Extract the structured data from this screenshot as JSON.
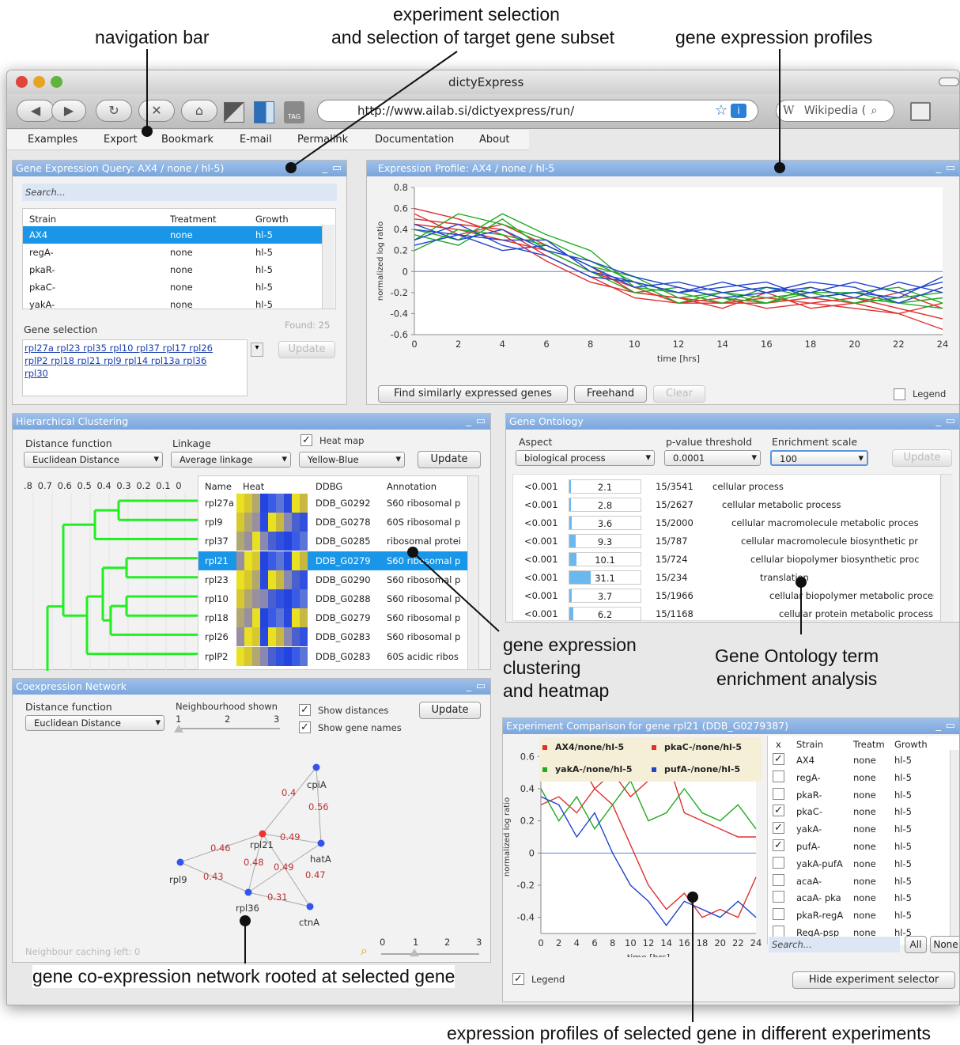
{
  "callouts": {
    "experiment_selection": "experiment selection\nand selection of target gene subset",
    "experiment_selection_l1": "experiment selection",
    "experiment_selection_l2": "and selection of target gene subset",
    "navigation_bar": "navigation bar",
    "gene_expression_profiles": "gene expression profiles",
    "clustering_l1": "gene expression",
    "clustering_l2": "clustering",
    "clustering_l3": "and heatmap",
    "go_l1": "Gene Ontology term",
    "go_l2": "enrichment analysis",
    "network": "gene co-expression network rooted at selected gene",
    "experiments": "expression profiles of selected gene in different experiments"
  },
  "browser": {
    "title": "dictyExpress",
    "url": "http://www.ailab.si/dictyexpress/run/",
    "search_engine": "Wikipedia (",
    "search_engine_icon": "W",
    "tag_label": "TAG"
  },
  "menu": [
    "Examples",
    "Export",
    "Bookmark",
    "E-mail",
    "Permalink",
    "Documentation",
    "About"
  ],
  "query_panel": {
    "title": "Gene Expression Query: AX4 / none / hl-5)",
    "search_placeholder": "Search...",
    "columns": [
      "Strain",
      "Treatment",
      "Growth"
    ],
    "rows": [
      [
        "AX4",
        "none",
        "hl-5"
      ],
      [
        "regA-",
        "none",
        "hl-5"
      ],
      [
        "pkaR-",
        "none",
        "hl-5"
      ],
      [
        "pkaC-",
        "none",
        "hl-5"
      ],
      [
        "yakA-",
        "none",
        "hl-5"
      ]
    ],
    "found": "Found: 25",
    "gene_selection_label": "Gene selection",
    "genes_line1": "rpl27a rpl23 rpl35 rpl10 rpl37 rpl17 rpl26",
    "genes_line2": "rplP2 rpl18 rpl21 rpl9 rpl14 rpl13a rpl36",
    "genes_line3": "rpl30",
    "update": "Update"
  },
  "profile_panel": {
    "title": "Expression Profile: AX4 / none / hl-5",
    "ylabel": "normalized log ratio",
    "xlabel": "time [hrs]",
    "btn_find": "Find similarly expressed genes",
    "btn_freehand": "Freehand",
    "btn_clear": "Clear",
    "legend": "Legend"
  },
  "chart_data": [
    {
      "type": "line",
      "title": "Expression Profile: AX4 / none / hl-5",
      "xlabel": "time [hrs]",
      "ylabel": "normalized log ratio",
      "x": [
        0,
        2,
        4,
        6,
        8,
        10,
        12,
        14,
        16,
        18,
        20,
        22,
        24
      ],
      "xticks": [
        "0",
        "2",
        "4",
        "6",
        "8",
        "10",
        "12",
        "14",
        "16",
        "18",
        "20",
        "22",
        "24"
      ],
      "yticks": [
        "0.8",
        "0.6",
        "0.4",
        "0.2",
        "0",
        "-0.2",
        "-0.4",
        "-0.6"
      ],
      "ylim": [
        -0.6,
        0.8
      ],
      "xlim": [
        0,
        24
      ],
      "series": [
        {
          "color": "#e03030",
          "values": [
            0.6,
            0.5,
            0.35,
            0.1,
            -0.1,
            -0.2,
            -0.25,
            -0.3,
            -0.25,
            -0.3,
            -0.35,
            -0.4,
            -0.55
          ]
        },
        {
          "color": "#e03030",
          "values": [
            0.5,
            0.45,
            0.4,
            0.15,
            -0.05,
            -0.25,
            -0.3,
            -0.25,
            -0.35,
            -0.3,
            -0.25,
            -0.35,
            -0.45
          ]
        },
        {
          "color": "#e03030",
          "values": [
            0.45,
            0.4,
            0.3,
            0.2,
            0.0,
            -0.15,
            -0.3,
            -0.3,
            -0.3,
            -0.25,
            -0.3,
            -0.2,
            -0.35
          ]
        },
        {
          "color": "#e03030",
          "values": [
            0.55,
            0.35,
            0.45,
            0.25,
            0.05,
            -0.2,
            -0.25,
            -0.35,
            -0.2,
            -0.35,
            -0.3,
            -0.4,
            -0.3
          ]
        },
        {
          "color": "#22aa22",
          "values": [
            0.3,
            0.55,
            0.45,
            0.3,
            0.1,
            -0.1,
            -0.3,
            -0.2,
            -0.3,
            -0.15,
            -0.25,
            -0.3,
            -0.25
          ]
        },
        {
          "color": "#22aa22",
          "values": [
            0.4,
            0.3,
            0.55,
            0.35,
            0.2,
            -0.15,
            -0.2,
            -0.3,
            -0.15,
            -0.25,
            -0.2,
            -0.15,
            -0.3
          ]
        },
        {
          "color": "#22aa22",
          "values": [
            0.2,
            0.4,
            0.35,
            0.25,
            0.05,
            -0.05,
            -0.25,
            -0.2,
            -0.25,
            -0.2,
            -0.3,
            -0.25,
            -0.2
          ]
        },
        {
          "color": "#22aa22",
          "values": [
            0.35,
            0.25,
            0.5,
            0.2,
            0.0,
            -0.2,
            -0.15,
            -0.25,
            -0.3,
            -0.2,
            -0.2,
            -0.3,
            -0.35
          ]
        },
        {
          "color": "#2244cc",
          "values": [
            0.25,
            0.35,
            0.3,
            0.3,
            0.0,
            -0.1,
            -0.2,
            -0.15,
            -0.1,
            -0.25,
            -0.2,
            -0.25,
            -0.05
          ]
        },
        {
          "color": "#2244cc",
          "values": [
            0.4,
            0.35,
            0.2,
            0.25,
            0.05,
            -0.15,
            -0.1,
            -0.2,
            -0.15,
            -0.2,
            -0.1,
            -0.2,
            -0.1
          ]
        },
        {
          "color": "#2244cc",
          "values": [
            0.3,
            0.45,
            0.25,
            0.15,
            -0.05,
            -0.1,
            -0.2,
            -0.1,
            -0.2,
            -0.15,
            -0.25,
            -0.1,
            -0.2
          ]
        },
        {
          "color": "#2244cc",
          "values": [
            0.45,
            0.3,
            0.4,
            0.2,
            0.1,
            -0.05,
            -0.15,
            -0.25,
            -0.2,
            -0.1,
            -0.15,
            -0.3,
            -0.15
          ]
        }
      ]
    },
    {
      "type": "line",
      "title": "Experiment Comparison for gene rpl21 (DDB_G0279387)",
      "xlabel": "time [hrs]",
      "ylabel": "normalized log ratio",
      "x": [
        0,
        2,
        4,
        6,
        8,
        10,
        12,
        14,
        16,
        18,
        20,
        22,
        24
      ],
      "xticks": [
        "0",
        "2",
        "4",
        "6",
        "8",
        "10",
        "12",
        "14",
        "16",
        "18",
        "20",
        "22",
        "24"
      ],
      "yticks": [
        "0.6",
        "0.4",
        "0.2",
        "0",
        "-0.2",
        "-0.4"
      ],
      "ylim": [
        -0.5,
        0.7
      ],
      "xlim": [
        0,
        24
      ],
      "series": [
        {
          "name": "AX4/none/hl-5",
          "color": "#e03030",
          "values": [
            0.3,
            0.35,
            0.25,
            0.4,
            0.3,
            0.05,
            -0.2,
            -0.35,
            -0.25,
            -0.4,
            -0.35,
            -0.4,
            -0.15
          ]
        },
        {
          "name": "pkaC-/none/hl-5",
          "color": "#e03030",
          "values": [
            0.55,
            0.45,
            0.6,
            0.4,
            0.5,
            0.35,
            0.45,
            0.6,
            0.25,
            0.2,
            0.15,
            0.1,
            0.1
          ]
        },
        {
          "name": "yakA-/none/hl-5",
          "color": "#22aa22",
          "values": [
            0.4,
            0.2,
            0.35,
            0.15,
            0.3,
            0.45,
            0.2,
            0.25,
            0.4,
            0.25,
            0.2,
            0.3,
            0.15
          ]
        },
        {
          "name": "pufA-/none/hl-5",
          "color": "#2244cc",
          "values": [
            0.35,
            0.3,
            0.1,
            0.25,
            0.0,
            -0.2,
            -0.3,
            -0.45,
            -0.3,
            -0.35,
            -0.4,
            -0.3,
            -0.4
          ]
        }
      ]
    }
  ],
  "clustering_panel": {
    "title": "Hierarchical Clustering",
    "distance_label": "Distance function",
    "distance_value": "Euclidean Distance",
    "linkage_label": "Linkage",
    "linkage_value": "Average linkage",
    "heatmap_label": "Heat map",
    "color_value": "Yellow-Blue",
    "update": "Update",
    "scale": ".8 0.7 0.6 0.5 0.4 0.3 0.2 0.1 0",
    "columns": [
      "Name",
      "Heat",
      "DDBG",
      "Annotation"
    ],
    "rows": [
      [
        "rpl27a",
        "DDB_G0292",
        "S60 ribosomal p"
      ],
      [
        "rpl9",
        "DDB_G0278",
        "60S ribosomal p"
      ],
      [
        "rpl37",
        "DDB_G0285",
        "ribosomal protei"
      ],
      [
        "rpl21",
        "DDB_G0279",
        "S60 ribosomal p"
      ],
      [
        "rpl23",
        "DDB_G0290",
        "S60 ribosomal p"
      ],
      [
        "rpl10",
        "DDB_G0288",
        "S60 ribosomal p"
      ],
      [
        "rpl18",
        "DDB_G0279",
        "S60 ribosomal p"
      ],
      [
        "rpl26",
        "DDB_G0283",
        "S60 ribosomal p"
      ],
      [
        "rplP2",
        "DDB_G0283",
        "60S acidic ribos"
      ]
    ]
  },
  "go_panel": {
    "title": "Gene Ontology",
    "aspect_label": "Aspect",
    "aspect_value": "biological process",
    "pvalue_label": "p-value threshold",
    "pvalue_value": "0.0001",
    "scale_label": "Enrichment scale",
    "scale_value": "100",
    "update": "Update",
    "rows": [
      {
        "p": "<0.001",
        "score": 2.1,
        "score_text": "2.1",
        "count": "15/3541",
        "term": "cellular process"
      },
      {
        "p": "<0.001",
        "score": 2.8,
        "score_text": "2.8",
        "count": "15/2627",
        "term": "cellular metabolic process"
      },
      {
        "p": "<0.001",
        "score": 3.6,
        "score_text": "3.6",
        "count": "15/2000",
        "term": "cellular macromolecule metabolic proces"
      },
      {
        "p": "<0.001",
        "score": 9.3,
        "score_text": "9.3",
        "count": "15/787",
        "term": "cellular macromolecule biosynthetic pr"
      },
      {
        "p": "<0.001",
        "score": 10.1,
        "score_text": "10.1",
        "count": "15/724",
        "term": "cellular biopolymer biosynthetic proc"
      },
      {
        "p": "<0.001",
        "score": 31.1,
        "score_text": "31.1",
        "count": "15/234",
        "term": "translation"
      },
      {
        "p": "<0.001",
        "score": 3.7,
        "score_text": "3.7",
        "count": "15/1966",
        "term": "cellular biopolymer metabolic process"
      },
      {
        "p": "<0.001",
        "score": 6.2,
        "score_text": "6.2",
        "count": "15/1168",
        "term": "cellular protein metabolic process"
      }
    ]
  },
  "network_panel": {
    "title": "Coexpression Network",
    "distance_label": "Distance function",
    "distance_value": "Euclidean Distance",
    "neigh_label": "Neighbourhood shown",
    "neigh_ticks": [
      "1",
      "2",
      "3"
    ],
    "show_distances": "Show distances",
    "show_names": "Show gene names",
    "update": "Update",
    "caching": "Neighbour caching left: 0",
    "depth_ticks": [
      "0",
      "1",
      "2",
      "3"
    ],
    "nodes": [
      "cpiA",
      "rpl21",
      "hatA",
      "rpl9",
      "rpl36",
      "ctnA"
    ],
    "edge_labels": [
      "0.4",
      "0.56",
      "0.49",
      "0.46",
      "0.48",
      "0.49",
      "0.47",
      "0.43",
      "0.31"
    ]
  },
  "experiment_panel": {
    "title": "Experiment Comparison for gene rpl21 (DDB_G0279387)",
    "legend": "Legend",
    "columns": [
      "x",
      "Strain",
      "Treatm",
      "Growth"
    ],
    "rows": [
      {
        "checked": true,
        "strain": "AX4",
        "treat": "none",
        "growth": "hl-5"
      },
      {
        "checked": false,
        "strain": "regA-",
        "treat": "none",
        "growth": "hl-5"
      },
      {
        "checked": false,
        "strain": "pkaR-",
        "treat": "none",
        "growth": "hl-5"
      },
      {
        "checked": true,
        "strain": "pkaC-",
        "treat": "none",
        "growth": "hl-5"
      },
      {
        "checked": true,
        "strain": "yakA-",
        "treat": "none",
        "growth": "hl-5"
      },
      {
        "checked": true,
        "strain": "pufA-",
        "treat": "none",
        "growth": "hl-5"
      },
      {
        "checked": false,
        "strain": "yakA-pufA",
        "treat": "none",
        "growth": "hl-5"
      },
      {
        "checked": false,
        "strain": "acaA-",
        "treat": "none",
        "growth": "hl-5"
      },
      {
        "checked": false,
        "strain": "acaA- pka",
        "treat": "none",
        "growth": "hl-5"
      },
      {
        "checked": false,
        "strain": "pkaR-regA",
        "treat": "none",
        "growth": "hl-5"
      },
      {
        "checked": false,
        "strain": "RegA-psp",
        "treat": "none",
        "growth": "hl-5"
      }
    ],
    "search_placeholder": "Search...",
    "all": "All",
    "none": "None",
    "hide": "Hide experiment selector"
  }
}
